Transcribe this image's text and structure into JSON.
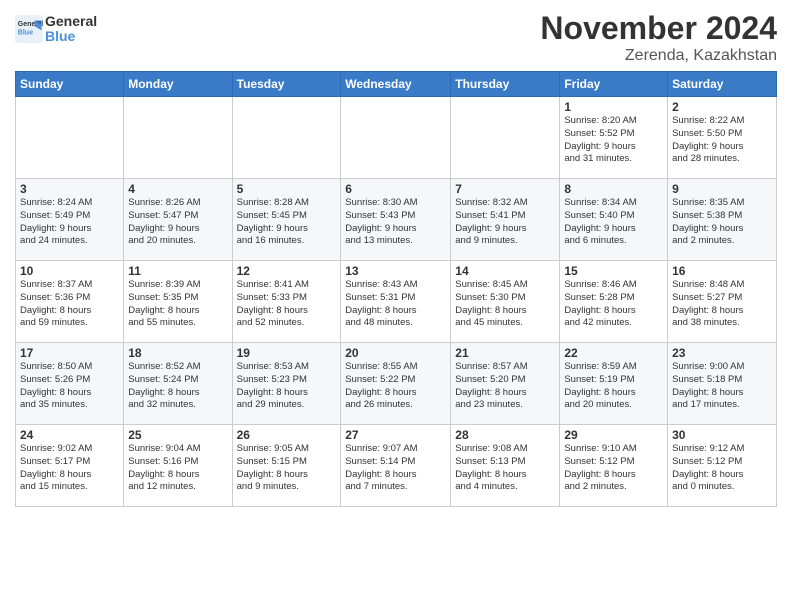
{
  "logo": {
    "line1": "General",
    "line2": "Blue"
  },
  "title": "November 2024",
  "location": "Zerenda, Kazakhstan",
  "days_of_week": [
    "Sunday",
    "Monday",
    "Tuesday",
    "Wednesday",
    "Thursday",
    "Friday",
    "Saturday"
  ],
  "weeks": [
    [
      {
        "day": "",
        "info": ""
      },
      {
        "day": "",
        "info": ""
      },
      {
        "day": "",
        "info": ""
      },
      {
        "day": "",
        "info": ""
      },
      {
        "day": "",
        "info": ""
      },
      {
        "day": "1",
        "info": "Sunrise: 8:20 AM\nSunset: 5:52 PM\nDaylight: 9 hours\nand 31 minutes."
      },
      {
        "day": "2",
        "info": "Sunrise: 8:22 AM\nSunset: 5:50 PM\nDaylight: 9 hours\nand 28 minutes."
      }
    ],
    [
      {
        "day": "3",
        "info": "Sunrise: 8:24 AM\nSunset: 5:49 PM\nDaylight: 9 hours\nand 24 minutes."
      },
      {
        "day": "4",
        "info": "Sunrise: 8:26 AM\nSunset: 5:47 PM\nDaylight: 9 hours\nand 20 minutes."
      },
      {
        "day": "5",
        "info": "Sunrise: 8:28 AM\nSunset: 5:45 PM\nDaylight: 9 hours\nand 16 minutes."
      },
      {
        "day": "6",
        "info": "Sunrise: 8:30 AM\nSunset: 5:43 PM\nDaylight: 9 hours\nand 13 minutes."
      },
      {
        "day": "7",
        "info": "Sunrise: 8:32 AM\nSunset: 5:41 PM\nDaylight: 9 hours\nand 9 minutes."
      },
      {
        "day": "8",
        "info": "Sunrise: 8:34 AM\nSunset: 5:40 PM\nDaylight: 9 hours\nand 6 minutes."
      },
      {
        "day": "9",
        "info": "Sunrise: 8:35 AM\nSunset: 5:38 PM\nDaylight: 9 hours\nand 2 minutes."
      }
    ],
    [
      {
        "day": "10",
        "info": "Sunrise: 8:37 AM\nSunset: 5:36 PM\nDaylight: 8 hours\nand 59 minutes."
      },
      {
        "day": "11",
        "info": "Sunrise: 8:39 AM\nSunset: 5:35 PM\nDaylight: 8 hours\nand 55 minutes."
      },
      {
        "day": "12",
        "info": "Sunrise: 8:41 AM\nSunset: 5:33 PM\nDaylight: 8 hours\nand 52 minutes."
      },
      {
        "day": "13",
        "info": "Sunrise: 8:43 AM\nSunset: 5:31 PM\nDaylight: 8 hours\nand 48 minutes."
      },
      {
        "day": "14",
        "info": "Sunrise: 8:45 AM\nSunset: 5:30 PM\nDaylight: 8 hours\nand 45 minutes."
      },
      {
        "day": "15",
        "info": "Sunrise: 8:46 AM\nSunset: 5:28 PM\nDaylight: 8 hours\nand 42 minutes."
      },
      {
        "day": "16",
        "info": "Sunrise: 8:48 AM\nSunset: 5:27 PM\nDaylight: 8 hours\nand 38 minutes."
      }
    ],
    [
      {
        "day": "17",
        "info": "Sunrise: 8:50 AM\nSunset: 5:26 PM\nDaylight: 8 hours\nand 35 minutes."
      },
      {
        "day": "18",
        "info": "Sunrise: 8:52 AM\nSunset: 5:24 PM\nDaylight: 8 hours\nand 32 minutes."
      },
      {
        "day": "19",
        "info": "Sunrise: 8:53 AM\nSunset: 5:23 PM\nDaylight: 8 hours\nand 29 minutes."
      },
      {
        "day": "20",
        "info": "Sunrise: 8:55 AM\nSunset: 5:22 PM\nDaylight: 8 hours\nand 26 minutes."
      },
      {
        "day": "21",
        "info": "Sunrise: 8:57 AM\nSunset: 5:20 PM\nDaylight: 8 hours\nand 23 minutes."
      },
      {
        "day": "22",
        "info": "Sunrise: 8:59 AM\nSunset: 5:19 PM\nDaylight: 8 hours\nand 20 minutes."
      },
      {
        "day": "23",
        "info": "Sunrise: 9:00 AM\nSunset: 5:18 PM\nDaylight: 8 hours\nand 17 minutes."
      }
    ],
    [
      {
        "day": "24",
        "info": "Sunrise: 9:02 AM\nSunset: 5:17 PM\nDaylight: 8 hours\nand 15 minutes."
      },
      {
        "day": "25",
        "info": "Sunrise: 9:04 AM\nSunset: 5:16 PM\nDaylight: 8 hours\nand 12 minutes."
      },
      {
        "day": "26",
        "info": "Sunrise: 9:05 AM\nSunset: 5:15 PM\nDaylight: 8 hours\nand 9 minutes."
      },
      {
        "day": "27",
        "info": "Sunrise: 9:07 AM\nSunset: 5:14 PM\nDaylight: 8 hours\nand 7 minutes."
      },
      {
        "day": "28",
        "info": "Sunrise: 9:08 AM\nSunset: 5:13 PM\nDaylight: 8 hours\nand 4 minutes."
      },
      {
        "day": "29",
        "info": "Sunrise: 9:10 AM\nSunset: 5:12 PM\nDaylight: 8 hours\nand 2 minutes."
      },
      {
        "day": "30",
        "info": "Sunrise: 9:12 AM\nSunset: 5:12 PM\nDaylight: 8 hours\nand 0 minutes."
      }
    ]
  ]
}
